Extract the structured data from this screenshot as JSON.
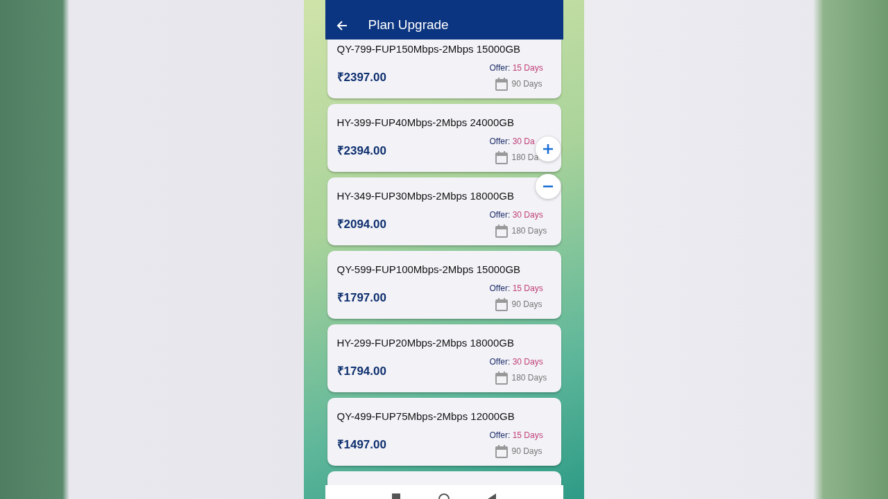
{
  "app_bar": {
    "title": "Plan Upgrade"
  },
  "plans": [
    {
      "name": "QY-799-FUP150Mbps-2Mbps 15000GB",
      "price": "₹2397.00",
      "offer_label": "Offer:",
      "offer_value": "15 Days",
      "validity": "90 Days"
    },
    {
      "name": "HY-399-FUP40Mbps-2Mbps 24000GB",
      "price": "₹2394.00",
      "offer_label": "Offer:",
      "offer_value": "30 Da",
      "validity": "180 Da"
    },
    {
      "name": "HY-349-FUP30Mbps-2Mbps 18000GB",
      "price": "₹2094.00",
      "offer_label": "Offer:",
      "offer_value": "30 Days",
      "validity": "180 Days"
    },
    {
      "name": "QY-599-FUP100Mbps-2Mbps 15000GB",
      "price": "₹1797.00",
      "offer_label": "Offer:",
      "offer_value": "15 Days",
      "validity": "90 Days"
    },
    {
      "name": "HY-299-FUP20Mbps-2Mbps 18000GB",
      "price": "₹1794.00",
      "offer_label": "Offer:",
      "offer_value": "30 Days",
      "validity": "180 Days"
    },
    {
      "name": "QY-499-FUP75Mbps-2Mbps 12000GB",
      "price": "₹1497.00",
      "offer_label": "Offer:",
      "offer_value": "15 Days",
      "validity": "90 Days"
    }
  ],
  "floating_buttons": [
    {
      "kind": "plus"
    },
    {
      "kind": "minus"
    }
  ]
}
